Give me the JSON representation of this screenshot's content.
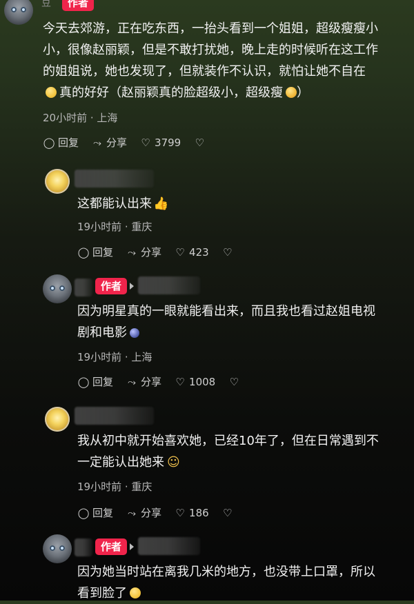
{
  "comments": [
    {
      "top_label": "豆",
      "author_badge": "作者",
      "text_lines": [
        "今天去郊游，正在吃东西，一抬头看到一个姐姐，超级瘦瘦小",
        "小，很像赵丽颖，但是不敢打扰她，晚上走的时候听在这工作",
        "的姐姐说，她也发现了，但就装作不认识，就怕让她不自在",
        "真的好好（赵丽颖真的脸超级小，超级瘦",
        "）"
      ],
      "meta": "20小时前 · 上海",
      "reply_label": "回复",
      "share_label": "分享",
      "likes": "3799"
    },
    {
      "text": "这都能认出来",
      "meta": "19小时前 · 重庆",
      "reply_label": "回复",
      "share_label": "分享",
      "likes": "423"
    },
    {
      "author_badge": "作者",
      "text_lines": [
        "因为明星真的一眼就能看出来，而且我也看过赵姐电视",
        "剧和电影"
      ],
      "meta": "19小时前 · 上海",
      "reply_label": "回复",
      "share_label": "分享",
      "likes": "1008"
    },
    {
      "text_lines": [
        "我从初中就开始喜欢她，已经10年了，但在日常遇到不",
        "一定能认出她来"
      ],
      "meta": "19小时前 · 重庆",
      "reply_label": "回复",
      "share_label": "分享",
      "likes": "186"
    },
    {
      "author_badge": "作者",
      "text_lines": [
        "因为她当时站在离我几米的地方，也没带上口罩，所以",
        "看到脸了"
      ]
    }
  ],
  "icons": {
    "reply": "speech-bubble-icon",
    "share": "share-arrow-icon",
    "like": "heart-icon",
    "dislike": "broken-heart-icon"
  },
  "colors": {
    "author_badge": "#f0244b",
    "background_top": "#2b3a1f",
    "background_bottom": "#070707"
  }
}
